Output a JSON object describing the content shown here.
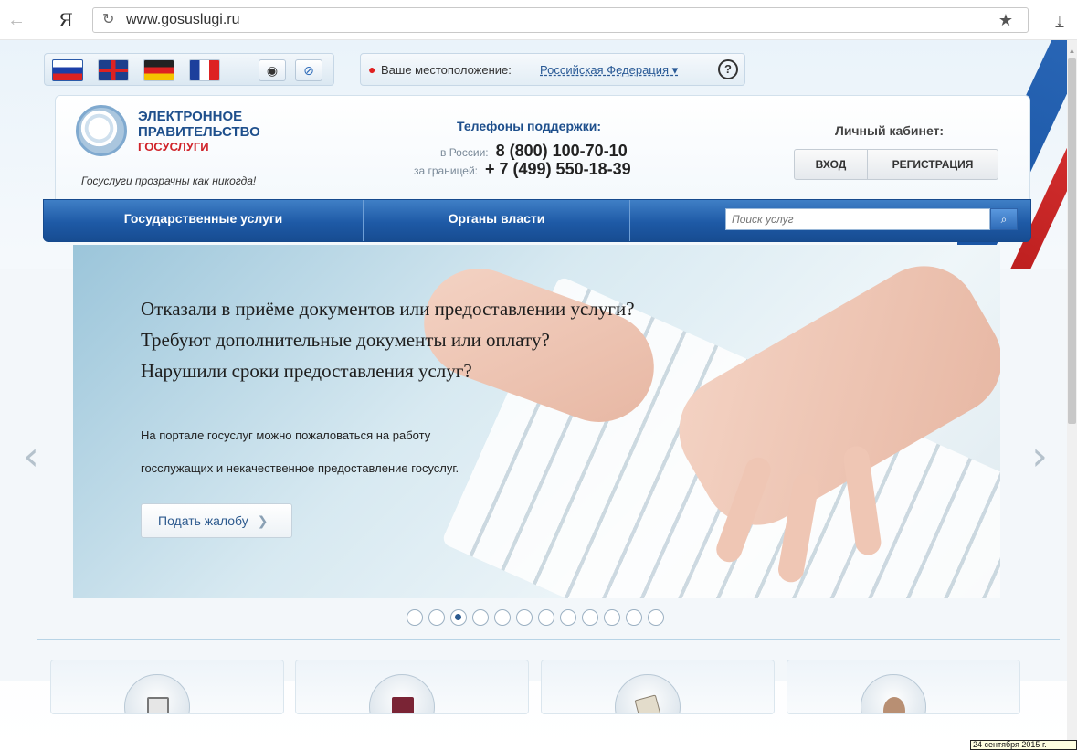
{
  "browser": {
    "back_icon": "arrow-left-icon",
    "ya_logo": "Я",
    "reload_icon": "reload-icon",
    "url": "www.gosuslugi.ru",
    "star_icon": "star-icon",
    "download_icon": "download-icon"
  },
  "toolbar": {
    "flags": [
      "ru-flag-icon",
      "gb-flag-icon",
      "de-flag-icon",
      "fr-flag-icon"
    ],
    "tools": [
      "eye-icon",
      "compass-icon"
    ],
    "location_label": "Ваше местоположение:",
    "location_value": "Российская Федерация ▾",
    "help_label": "?"
  },
  "header": {
    "logo_line1": "ЭЛЕКТРОННОЕ",
    "logo_line2": "ПРАВИТЕЛЬСТВО",
    "logo_line3": "ГОСУСЛУГИ",
    "tagline": "Госуслуги прозрачны как никогда!",
    "support_title": "Телефоны поддержки:",
    "support_ru_label": "в России:",
    "support_ru_number": "8 (800) 100-70-10",
    "support_abroad_label": "за границей:",
    "support_abroad_number": "+ 7 (499) 550-18-39",
    "cabinet_title": "Личный кабинет:",
    "login_label": "ВХОД",
    "register_label": "РЕГИСТРАЦИЯ"
  },
  "nav": {
    "services": "Государственные услуги",
    "authorities": "Органы власти",
    "search_placeholder": "Поиск услуг"
  },
  "hero": {
    "heading1": "Отказали в приёме документов или предоставлении услуги?",
    "heading2": "Требуют дополнительные документы или оплату?",
    "heading3": "Нарушили сроки предоставления услуг?",
    "text1": "На портале госуслуг можно пожаловаться на работу",
    "text2": "госслужащих и некачественное предоставление госуслуг.",
    "button_label": "Подать жалобу",
    "button_chevron": "❯",
    "prev_arrow": "‹",
    "next_arrow": "›"
  },
  "pager": {
    "total": 12,
    "active_index": 2
  },
  "tiles": [
    "calendar-icon",
    "passport-icon",
    "document-icon",
    "seal-icon"
  ],
  "date_tip": "24 сентября 2015 г."
}
